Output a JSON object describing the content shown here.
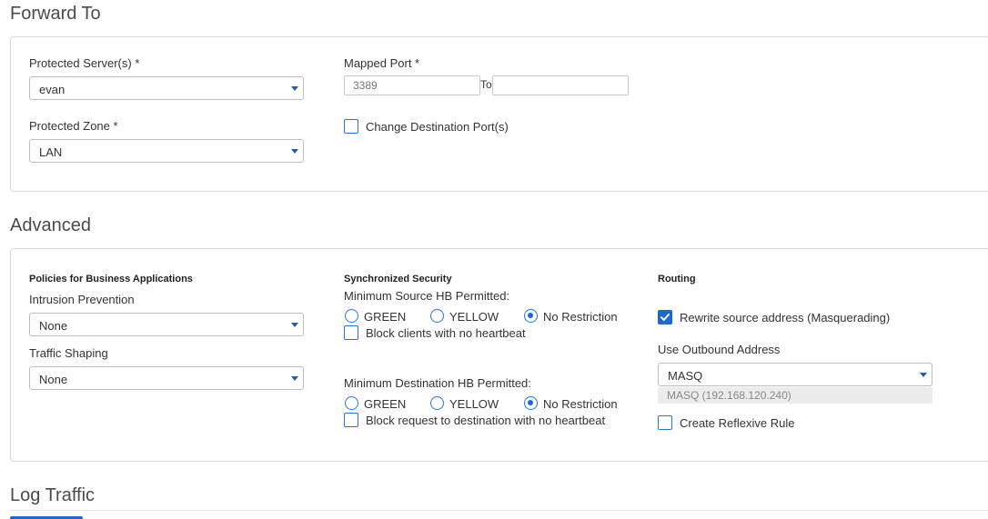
{
  "forward_to": {
    "title": "Forward To",
    "protected_servers_label": "Protected Server(s) *",
    "protected_servers_value": "evan",
    "protected_zone_label": "Protected Zone *",
    "protected_zone_value": "LAN",
    "mapped_port_label": "Mapped Port *",
    "mapped_port_from_placeholder": "3389",
    "mapped_port_to_label": "To",
    "mapped_port_to_value": "",
    "change_destination_ports_label": "Change Destination Port(s)",
    "change_destination_ports_checked": false
  },
  "advanced": {
    "title": "Advanced",
    "policies": {
      "heading": "Policies for Business Applications",
      "intrusion_prevention_label": "Intrusion Prevention",
      "intrusion_prevention_value": "None",
      "traffic_shaping_label": "Traffic Shaping",
      "traffic_shaping_value": "None"
    },
    "sync_security": {
      "heading": "Synchronized Security",
      "min_source_label": "Minimum Source HB Permitted:",
      "source_options": [
        "GREEN",
        "YELLOW",
        "No Restriction"
      ],
      "source_selected": "No Restriction",
      "block_clients_label": "Block clients with no heartbeat",
      "block_clients_checked": false,
      "min_dest_label": "Minimum Destination HB Permitted:",
      "dest_options": [
        "GREEN",
        "YELLOW",
        "No Restriction"
      ],
      "dest_selected": "No Restriction",
      "block_request_label": "Block request to destination with no heartbeat",
      "block_request_checked": false
    },
    "routing": {
      "heading": "Routing",
      "rewrite_source_label": "Rewrite source address (Masquerading)",
      "rewrite_source_checked": true,
      "outbound_label": "Use Outbound Address",
      "outbound_value": "MASQ",
      "outbound_detail": "MASQ (192.168.120.240)",
      "reflexive_label": "Create Reflexive Rule",
      "reflexive_checked": false
    }
  },
  "log_traffic": {
    "title": "Log Traffic"
  },
  "colors": {
    "accent": "#1d68cf",
    "border": "#d9d9d9"
  }
}
